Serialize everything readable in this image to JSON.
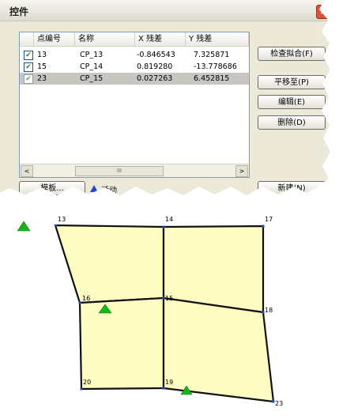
{
  "dialog": {
    "title": "控件",
    "close_glyph": "×",
    "columns": [
      "点编号",
      "名称",
      "X 残差",
      "Y 残差"
    ],
    "rows": [
      {
        "id": "13",
        "name": "CP_13",
        "x_residual": "-0.846543",
        "y_residual": "7.325871",
        "checked": true,
        "selected": false
      },
      {
        "id": "15",
        "name": "CP_14",
        "x_residual": "0.819280",
        "y_residual": "-13.778686",
        "checked": true,
        "selected": false
      },
      {
        "id": "23",
        "name": "CP_15",
        "x_residual": "0.027263",
        "y_residual": "6.452815",
        "checked": true,
        "selected": true
      }
    ],
    "check_glyph": "✔",
    "buttons": {
      "check_fit": "检查拟合(F)",
      "pan_to": "平移至(P)",
      "edit": "编辑(E)",
      "delete": "删除(D)",
      "template": "模板...",
      "new": "新建(N)"
    },
    "legend_label": "活动",
    "scroll_left": "<",
    "scroll_right": ">",
    "scroll_thumb": "III",
    "colors": {
      "active_marker": "#1e4fc4",
      "row_selected": "#c8c6c0"
    }
  },
  "map": {
    "vertex_labels": {
      "v13": "13",
      "v14": "14",
      "v17": "17",
      "v16": "16",
      "v15": "15",
      "v18": "18",
      "v20": "20",
      "v19": "19",
      "v23": "23"
    },
    "colors": {
      "polygon_fill": "#fdfcc2",
      "control_point": "#19b419",
      "edge": "#111111"
    }
  }
}
